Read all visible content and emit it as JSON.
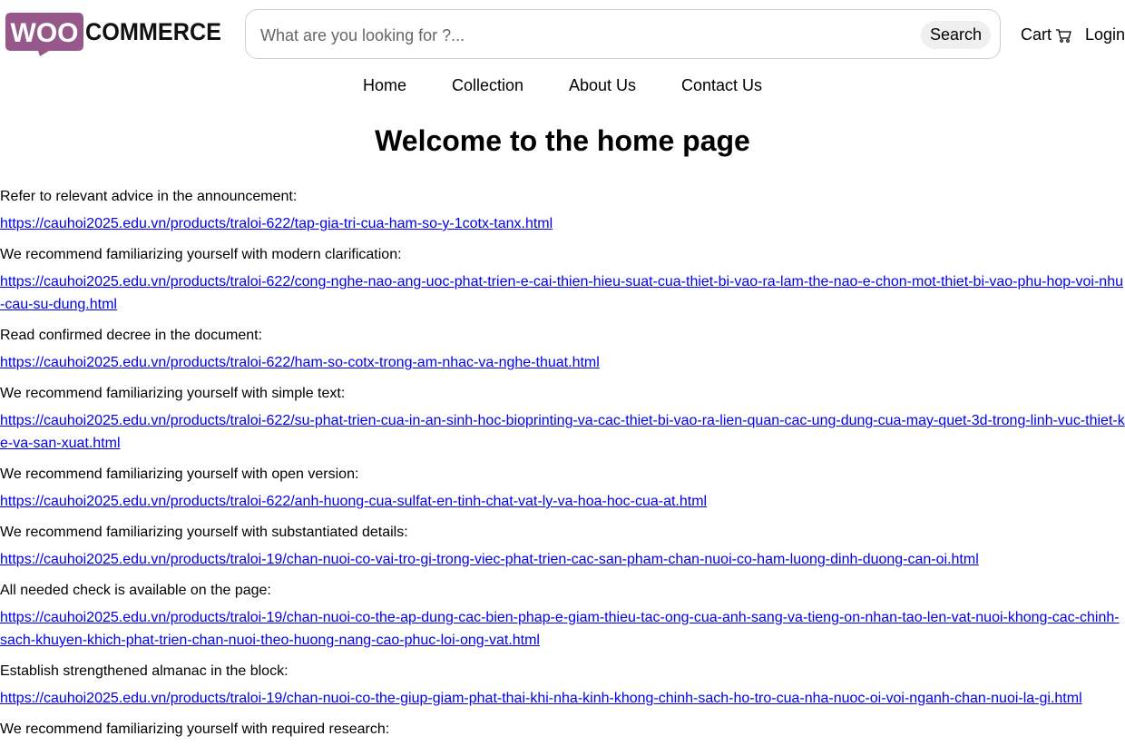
{
  "header": {
    "logo_woo": "WOO",
    "logo_commerce": "COMMERCE",
    "search_placeholder": "What are you looking for ?...",
    "search_button": "Search",
    "cart_label": "Cart",
    "login_label": "Login"
  },
  "nav": {
    "items": [
      "Home",
      "Collection",
      "About Us",
      "Contact Us"
    ]
  },
  "main": {
    "title": "Welcome to the home page",
    "entries": [
      {
        "label": "Refer to relevant advice in the announcement:",
        "link": "https://cauhoi2025.edu.vn/products/traloi-622/tap-gia-tri-cua-ham-so-y-1cotx-tanx.html"
      },
      {
        "label": "We recommend familiarizing yourself with modern clarification:",
        "link": "https://cauhoi2025.edu.vn/products/traloi-622/cong-nghe-nao-ang-uoc-phat-trien-e-cai-thien-hieu-suat-cua-thiet-bi-vao-ra-lam-the-nao-e-chon-mot-thiet-bi-vao-phu-hop-voi-nhu-cau-su-dung.html"
      },
      {
        "label": "Read confirmed decree in the document:",
        "link": "https://cauhoi2025.edu.vn/products/traloi-622/ham-so-cotx-trong-am-nhac-va-nghe-thuat.html"
      },
      {
        "label": "We recommend familiarizing yourself with simple text:",
        "link": "https://cauhoi2025.edu.vn/products/traloi-622/su-phat-trien-cua-in-an-sinh-hoc-bioprinting-va-cac-thiet-bi-vao-ra-lien-quan-cac-ung-dung-cua-may-quet-3d-trong-linh-vuc-thiet-ke-va-san-xuat.html"
      },
      {
        "label": "We recommend familiarizing yourself with open version:",
        "link": "https://cauhoi2025.edu.vn/products/traloi-622/anh-huong-cua-sulfat-en-tinh-chat-vat-ly-va-hoa-hoc-cua-at.html"
      },
      {
        "label": "We recommend familiarizing yourself with substantiated details:",
        "link": "https://cauhoi2025.edu.vn/products/traloi-19/chan-nuoi-co-vai-tro-gi-trong-viec-phat-trien-cac-san-pham-chan-nuoi-co-ham-luong-dinh-duong-can-oi.html"
      },
      {
        "label": "All needed check is available on the page:",
        "link": "https://cauhoi2025.edu.vn/products/traloi-19/chan-nuoi-co-the-ap-dung-cac-bien-phap-e-giam-thieu-tac-ong-cua-anh-sang-va-tieng-on-nhan-tao-len-vat-nuoi-khong-cac-chinh-sach-khuyen-khich-phat-trien-chan-nuoi-theo-huong-nang-cao-phuc-loi-ong-vat.html"
      },
      {
        "label": "Establish strengthened almanac in the block:",
        "link": "https://cauhoi2025.edu.vn/products/traloi-19/chan-nuoi-co-the-giup-giam-phat-thai-khi-nha-kinh-khong-chinh-sach-ho-tro-cua-nha-nuoc-oi-voi-nganh-chan-nuoi-la-gi.html"
      },
      {
        "label": "We recommend familiarizing yourself with required research:",
        "link": ""
      }
    ]
  },
  "colors": {
    "brand_purple": "#96588a",
    "link": "#0000ee"
  }
}
